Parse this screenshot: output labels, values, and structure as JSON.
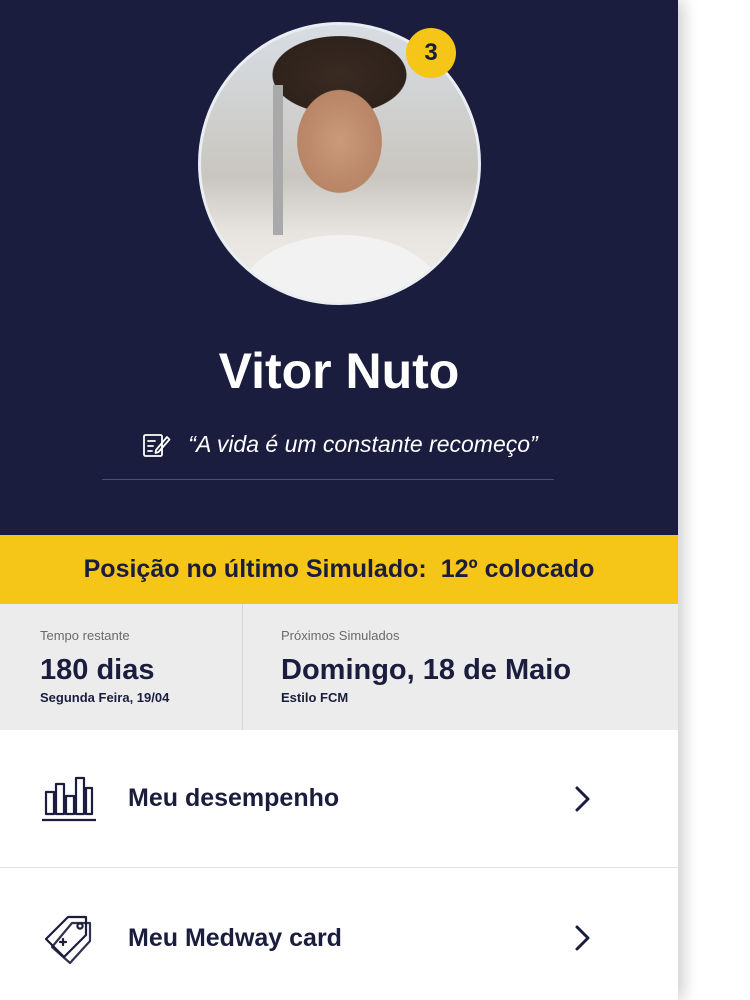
{
  "profile": {
    "name": "Vitor Nuto",
    "motto": "“A vida é um constante recomeço”",
    "notification_count": "3",
    "avatar_icon": "user-photo"
  },
  "ranking": {
    "label": "Posição no último Simulado:",
    "value": "12º colocado"
  },
  "info": {
    "time_left": {
      "label": "Tempo restante",
      "value": "180 dias",
      "sub": "Segunda Feira, 19/04"
    },
    "next_exams": {
      "label": "Próximos Simulados",
      "value": "Domingo, 18 de Maio",
      "sub": "Estilo FCM"
    }
  },
  "menu": [
    {
      "label": "Meu desempenho",
      "icon": "bar-chart-icon"
    },
    {
      "label": "Meu Medway card",
      "icon": "tag-card-icon"
    }
  ],
  "colors": {
    "navy": "#1a1d3d",
    "accent_yellow": "#f5c518",
    "info_bg": "#ececec"
  }
}
